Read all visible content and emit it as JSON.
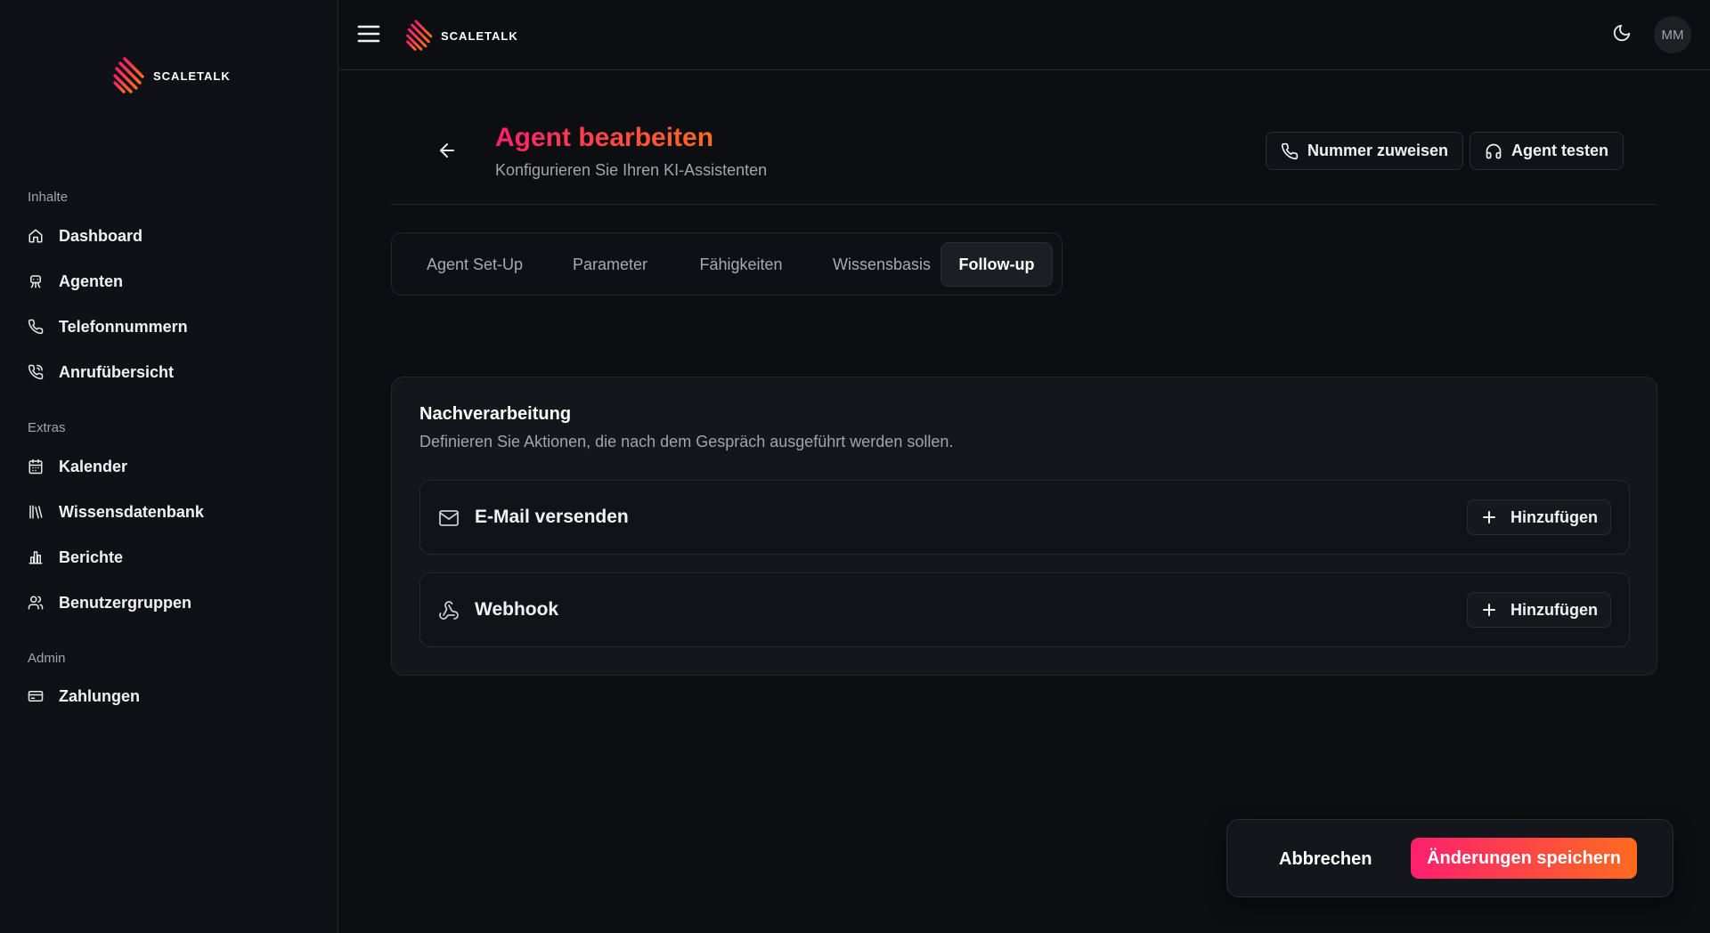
{
  "brand": {
    "name": "SCALETALK",
    "colors": {
      "gradient_start": "#ff1f6f",
      "gradient_end": "#ff6b1f"
    }
  },
  "sidebar": {
    "sections": [
      {
        "label": "Inhalte",
        "items": [
          {
            "label": "Dashboard",
            "icon": "home-icon"
          },
          {
            "label": "Agenten",
            "icon": "bot-icon"
          },
          {
            "label": "Telefonnummern",
            "icon": "phone-icon"
          },
          {
            "label": "Anrufübersicht",
            "icon": "phone-call-icon"
          }
        ]
      },
      {
        "label": "Extras",
        "items": [
          {
            "label": "Kalender",
            "icon": "calendar-icon"
          },
          {
            "label": "Wissensdatenbank",
            "icon": "library-icon"
          },
          {
            "label": "Berichte",
            "icon": "bar-chart-icon"
          },
          {
            "label": "Benutzergruppen",
            "icon": "users-icon"
          }
        ]
      },
      {
        "label": "Admin",
        "items": [
          {
            "label": "Zahlungen",
            "icon": "credit-card-icon"
          }
        ]
      }
    ]
  },
  "topbar": {
    "avatar_initials": "MM"
  },
  "header": {
    "title": "Agent bearbeiten",
    "subtitle": "Konfigurieren Sie Ihren KI-Assistenten",
    "assign_number_label": "Nummer zuweisen",
    "test_agent_label": "Agent testen"
  },
  "tabs": [
    {
      "label": "Agent Set-Up",
      "active": false
    },
    {
      "label": "Parameter",
      "active": false
    },
    {
      "label": "Fähigkeiten",
      "active": false
    },
    {
      "label": "Wissensbasis",
      "active": false
    },
    {
      "label": "Follow-up",
      "active": true
    }
  ],
  "postprocessing": {
    "title": "Nachverarbeitung",
    "description": "Definieren Sie Aktionen, die nach dem Gespräch ausgeführt werden sollen.",
    "actions": [
      {
        "label": "E-Mail versenden",
        "icon": "mail-icon",
        "button_label": "Hinzufügen"
      },
      {
        "label": "Webhook",
        "icon": "webhook-icon",
        "button_label": "Hinzufügen"
      }
    ]
  },
  "footer": {
    "cancel_label": "Abbrechen",
    "save_label": "Änderungen speichern"
  }
}
